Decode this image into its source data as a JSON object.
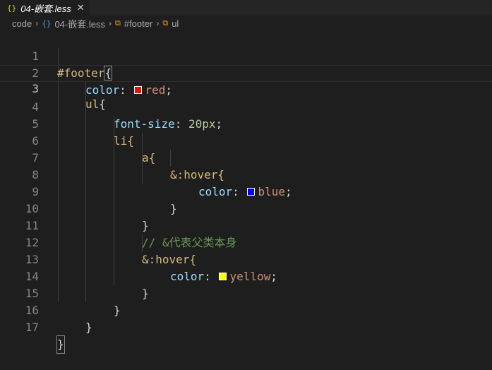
{
  "tab": {
    "icon": "{}",
    "title": "04-嵌套.less",
    "close": "✕"
  },
  "breadcrumb": {
    "items": [
      {
        "label": "code",
        "icon": ""
      },
      {
        "label": "04-嵌套.less",
        "icon": "{}"
      },
      {
        "label": "#footer",
        "icon": "⧉"
      },
      {
        "label": "ul",
        "icon": "⧉"
      }
    ]
  },
  "colors": {
    "red": "#e51400",
    "blue": "#0000ff",
    "yellow": "#ffff00"
  },
  "editor": {
    "lines": [
      {
        "n": "1",
        "t": "#footer{"
      },
      {
        "n": "2",
        "prop": "color",
        "val": "red"
      },
      {
        "n": "3",
        "t": "ul{"
      },
      {
        "n": "4",
        "prop": "font-size",
        "num": "20px"
      },
      {
        "n": "5",
        "t": "li{"
      },
      {
        "n": "6",
        "t": "a{"
      },
      {
        "n": "7",
        "t": "&:hover{"
      },
      {
        "n": "8",
        "prop": "color",
        "val": "blue"
      },
      {
        "n": "9",
        "t": "}"
      },
      {
        "n": "10",
        "t": "}"
      },
      {
        "n": "11",
        "comment": "// &代表父类本身"
      },
      {
        "n": "12",
        "t": "&:hover{"
      },
      {
        "n": "13",
        "prop": "color",
        "val": "yellow"
      },
      {
        "n": "14",
        "t": "}"
      },
      {
        "n": "15",
        "t": "}"
      },
      {
        "n": "16",
        "t": "}"
      },
      {
        "n": "17",
        "t": "}"
      }
    ]
  }
}
